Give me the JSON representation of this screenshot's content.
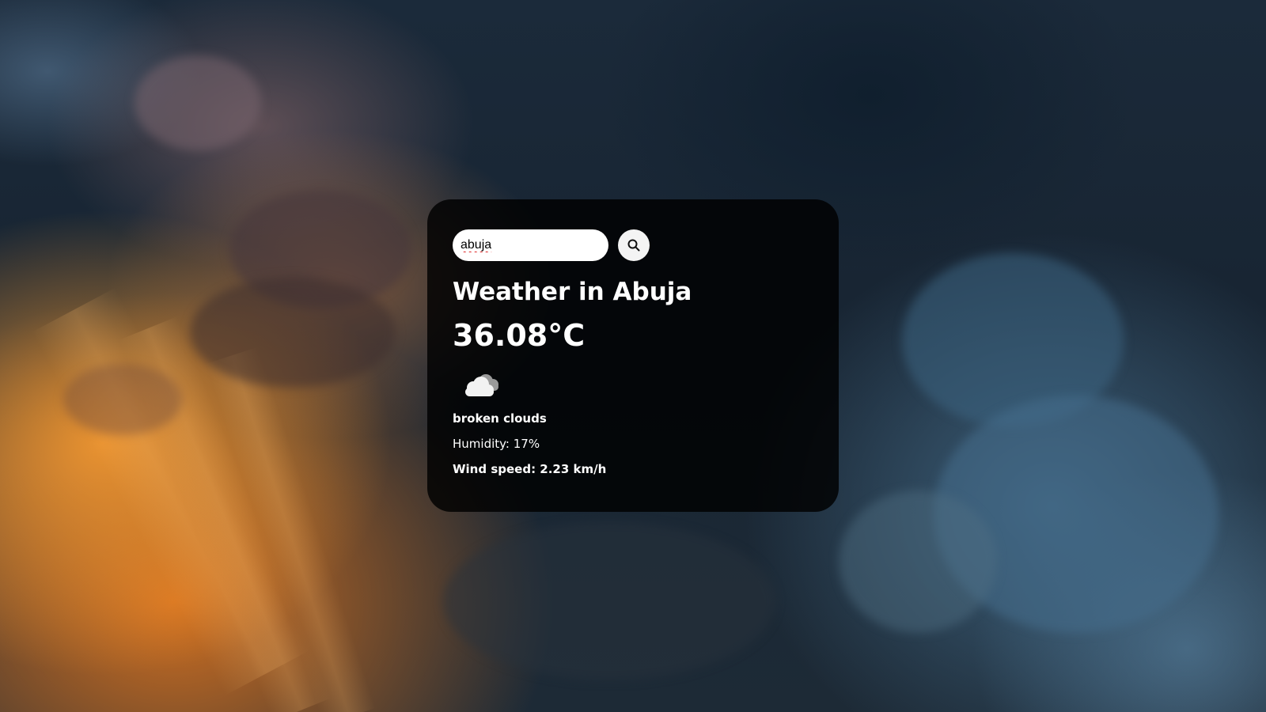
{
  "search": {
    "value": "abuja",
    "button_icon": "search-icon"
  },
  "weather": {
    "title": "Weather in Abuja",
    "temperature": "36.08°C",
    "icon": "broken-clouds-icon",
    "description": "broken clouds",
    "humidity": "Humidity: 17%",
    "wind": "Wind speed: 2.23 km/h"
  },
  "theme": {
    "card_background": "#000000",
    "text_color": "#ffffff",
    "input_background": "#ffffff",
    "button_background": "#f4f4f4"
  }
}
